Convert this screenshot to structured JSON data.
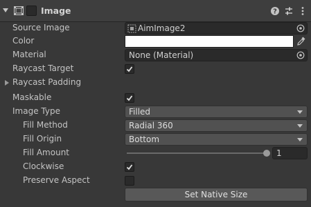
{
  "header": {
    "title": "Image",
    "enabled": false,
    "icons": [
      "image-component-icon",
      "help-icon",
      "presets-icon",
      "kebab-menu-icon"
    ]
  },
  "fields": {
    "source_image": {
      "label": "Source Image",
      "value": "AimImage2"
    },
    "color": {
      "label": "Color",
      "value": "#ffffff"
    },
    "material": {
      "label": "Material",
      "value": "None (Material)"
    },
    "raycast_target": {
      "label": "Raycast Target",
      "checked": true
    },
    "raycast_padding": {
      "label": "Raycast Padding"
    },
    "maskable": {
      "label": "Maskable",
      "checked": true
    },
    "image_type": {
      "label": "Image Type",
      "value": "Filled"
    },
    "fill_method": {
      "label": "Fill Method",
      "value": "Radial 360"
    },
    "fill_origin": {
      "label": "Fill Origin",
      "value": "Bottom"
    },
    "fill_amount": {
      "label": "Fill Amount",
      "value": "1",
      "fraction": 1.0
    },
    "clockwise": {
      "label": "Clockwise",
      "checked": true
    },
    "preserve_aspect": {
      "label": "Preserve Aspect",
      "checked": false
    }
  },
  "buttons": {
    "set_native_size": "Set Native Size"
  },
  "colors": {
    "background": "#383838",
    "field": "#2a2a2a",
    "dropdown": "#515151",
    "text": "#c4c4c4"
  }
}
